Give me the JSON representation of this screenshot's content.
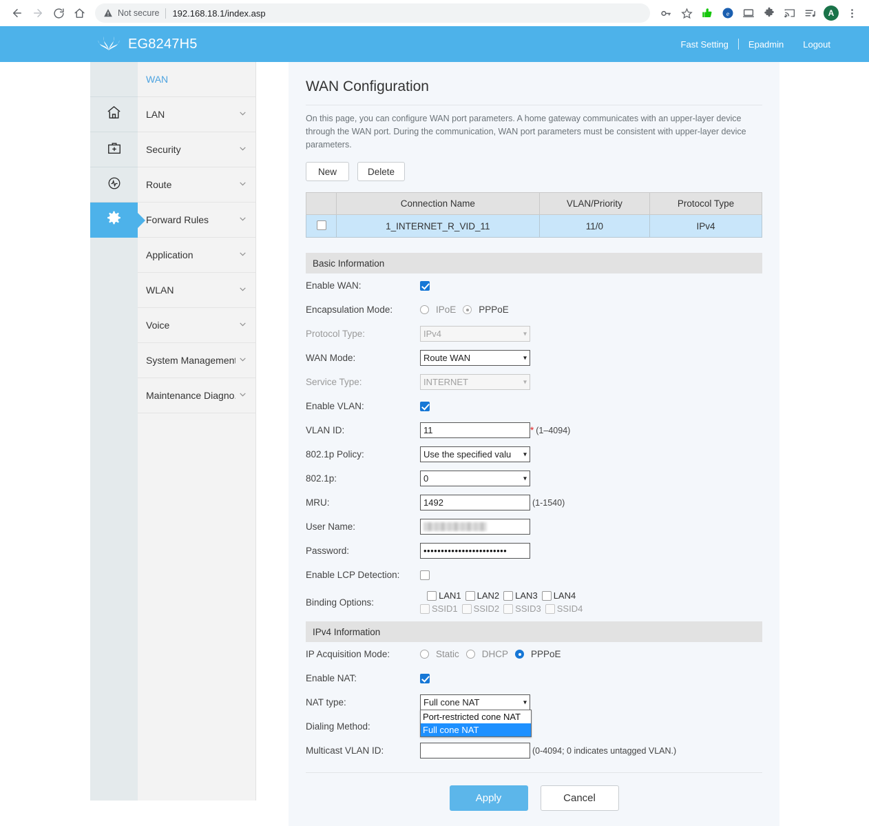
{
  "browser": {
    "back_icon": "back-arrow-icon",
    "forward_icon": "forward-arrow-icon",
    "reload_icon": "reload-icon",
    "home_icon": "home-icon",
    "security_label": "Not secure",
    "url": "192.168.18.1/index.asp",
    "toolbar_icons": [
      "key-icon",
      "star-icon",
      "green-thumb-icon",
      "edge-e-icon",
      "monitor-icon",
      "puzzle-extension-icon",
      "cast-icon",
      "playlist-icon"
    ],
    "avatar_letter": "A",
    "menu_icon": "three-dot-menu-icon"
  },
  "header": {
    "logo": "huawei-logo-icon",
    "model": "EG8247H5",
    "links": [
      "Fast Setting",
      "Epadmin",
      "Logout"
    ]
  },
  "rail": {
    "items": [
      {
        "icon": "blank-rail-slot",
        "active": false
      },
      {
        "icon": "home-icon",
        "active": false
      },
      {
        "icon": "toolbox-icon",
        "active": false
      },
      {
        "icon": "status-pulse-icon",
        "active": false
      },
      {
        "icon": "gear-icon",
        "active": true
      }
    ]
  },
  "sidebar": {
    "items": [
      {
        "label": "WAN",
        "active": true,
        "expandable": false
      },
      {
        "label": "LAN",
        "active": false,
        "expandable": true
      },
      {
        "label": "Security",
        "active": false,
        "expandable": true
      },
      {
        "label": "Route",
        "active": false,
        "expandable": true
      },
      {
        "label": "Forward Rules",
        "active": false,
        "expandable": true
      },
      {
        "label": "Application",
        "active": false,
        "expandable": true
      },
      {
        "label": "WLAN",
        "active": false,
        "expandable": true
      },
      {
        "label": "Voice",
        "active": false,
        "expandable": true
      },
      {
        "label": "System Management",
        "active": false,
        "expandable": true
      },
      {
        "label": "Maintenance Diagno..",
        "active": false,
        "expandable": true
      }
    ]
  },
  "main": {
    "title": "WAN Configuration",
    "description": "On this page, you can configure WAN port parameters. A home gateway communicates with an upper-layer device through the WAN port. During the communication, WAN port parameters must be consistent with upper-layer device parameters.",
    "new_button": "New",
    "delete_button": "Delete",
    "table": {
      "headers": [
        "",
        "Connection Name",
        "VLAN/Priority",
        "Protocol Type"
      ],
      "rows": [
        {
          "checked": false,
          "connection_name": "1_INTERNET_R_VID_11",
          "vlan_priority": "11/0",
          "protocol_type": "IPv4"
        }
      ]
    },
    "basic_section": "Basic Information",
    "fields": {
      "enable_wan_label": "Enable WAN:",
      "enable_wan_checked": true,
      "encapsulation_label": "Encapsulation Mode:",
      "encapsulation_options": [
        "IPoE",
        "PPPoE"
      ],
      "encapsulation_value": "PPPoE",
      "protocol_type_label": "Protocol Type:",
      "protocol_type_value": "IPv4",
      "wan_mode_label": "WAN Mode:",
      "wan_mode_value": "Route WAN",
      "service_type_label": "Service Type:",
      "service_type_value": "INTERNET",
      "enable_vlan_label": "Enable VLAN:",
      "enable_vlan_checked": true,
      "vlan_id_label": "VLAN ID:",
      "vlan_id_value": "11",
      "vlan_id_required": "*",
      "vlan_id_hint": "(1–4094)",
      "dot1p_policy_label": "802.1p Policy:",
      "dot1p_policy_value": "Use the specified valu",
      "dot1p_label": "802.1p:",
      "dot1p_value": "0",
      "mru_label": "MRU:",
      "mru_value": "1492",
      "mru_hint": "(1-1540)",
      "username_label": "User Name:",
      "username_value": "",
      "password_label": "Password:",
      "password_value": "••••••••••••••••••••••••",
      "lcp_label": "Enable LCP Detection:",
      "lcp_checked": false,
      "binding_label": "Binding Options:",
      "binding_lan": [
        "LAN1",
        "LAN2",
        "LAN3",
        "LAN4"
      ],
      "binding_ssid": [
        "SSID1",
        "SSID2",
        "SSID3",
        "SSID4"
      ]
    },
    "ipv4_section": "IPv4 Information",
    "ipv4": {
      "acquisition_label": "IP Acquisition Mode:",
      "acquisition_options": [
        "Static",
        "DHCP",
        "PPPoE"
      ],
      "acquisition_value": "PPPoE",
      "enable_nat_label": "Enable NAT:",
      "enable_nat_checked": true,
      "nat_type_label": "NAT type:",
      "nat_type_value": "Full cone NAT",
      "nat_type_options": [
        "Port-restricted cone NAT",
        "Full cone NAT"
      ],
      "nat_type_open": true,
      "dialing_method_label": "Dialing Method:",
      "multicast_vlan_label": "Multicast VLAN ID:",
      "multicast_vlan_value": "",
      "multicast_vlan_hint": "(0-4094; 0 indicates untagged VLAN.)"
    },
    "apply_button": "Apply",
    "cancel_button": "Cancel"
  },
  "colors": {
    "brand_blue": "#4db2ea",
    "accent_blue": "#1677d6",
    "selection_blue": "#1e90ff",
    "row_highlight": "#c9e6fa",
    "section_grey": "#e2e2e2"
  }
}
